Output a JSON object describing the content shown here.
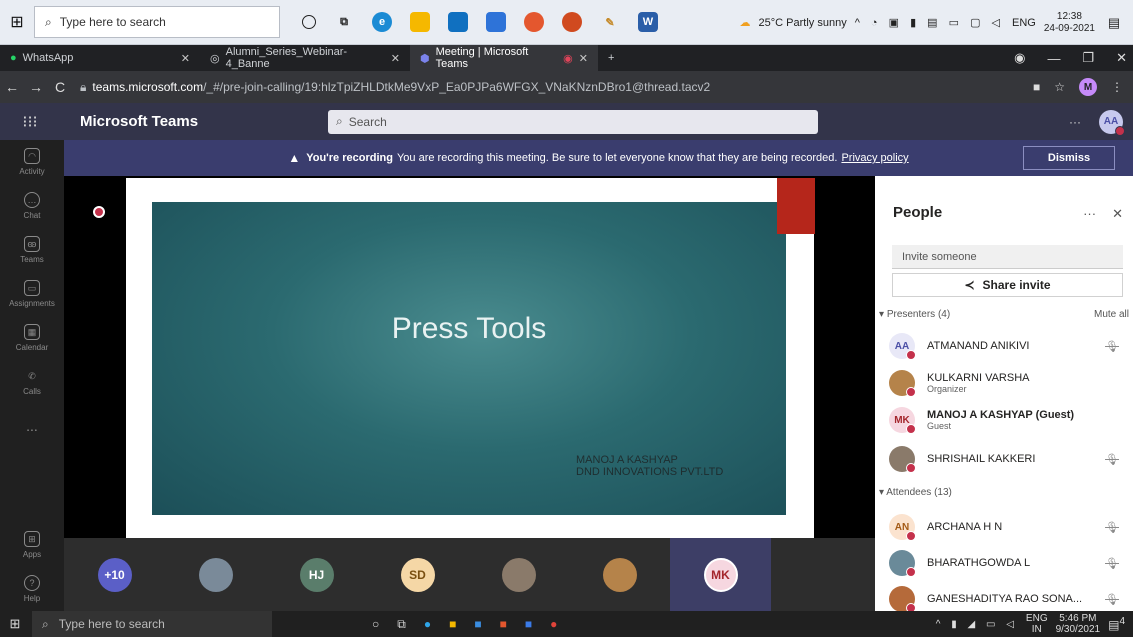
{
  "top_taskbar": {
    "search_placeholder": "Type here to search",
    "weather": "25°C  Partly sunny",
    "language": "ENG",
    "time": "12:38",
    "date": "24-09-2021"
  },
  "browser": {
    "tabs": [
      {
        "label": "WhatsApp",
        "icon": "whatsapp-icon"
      },
      {
        "label": "Alumni_Series_Webinar-4_Banne",
        "icon": "globe-icon"
      },
      {
        "label": "Meeting | Microsoft Teams",
        "icon": "teams-icon",
        "active": true
      }
    ],
    "new_tab": "+",
    "url_host": "teams.microsoft.com",
    "url_path": "/_#/pre-join-calling/19:hlzTpiZHLDtkMe9VxP_Ea0PJPa6WFGX_VNaKNznDBro1@thread.tacv2",
    "profile_initial": "M"
  },
  "teams": {
    "app_name": "Microsoft Teams",
    "search_placeholder": "Search",
    "user_initials": "AA",
    "more": "···"
  },
  "rail": {
    "items": [
      {
        "label": "Activity",
        "icon": "bell-icon"
      },
      {
        "label": "Chat",
        "icon": "chat-icon"
      },
      {
        "label": "Teams",
        "icon": "teams-group-icon"
      },
      {
        "label": "Assignments",
        "icon": "assignments-icon"
      },
      {
        "label": "Calendar",
        "icon": "calendar-icon"
      },
      {
        "label": "Calls",
        "icon": "phone-icon"
      },
      {
        "label": "...",
        "icon": "more-icon"
      }
    ],
    "bottom": [
      {
        "label": "Apps",
        "icon": "apps-icon"
      },
      {
        "label": "Help",
        "icon": "help-icon"
      }
    ]
  },
  "recording_banner": {
    "strong": "You're recording",
    "message": "You are recording this meeting. Be sure to let everyone know that they are being recorded.",
    "link": "Privacy policy",
    "dismiss": "Dismiss"
  },
  "slide": {
    "title": "Press Tools",
    "author_line1": "MANOJ A KASHYAP",
    "author_line2": "DND INNOVATIONS PVT.LTD"
  },
  "strip": [
    {
      "label": "+10",
      "color": "#5b5fc7",
      "kind": "count"
    },
    {
      "label": "",
      "color": "#7a8a99",
      "kind": "photo"
    },
    {
      "label": "HJ",
      "color": "#5a7d6b",
      "kind": "initials"
    },
    {
      "label": "SD",
      "color": "#f5d7a6",
      "text_color": "#7a4f10",
      "kind": "initials"
    },
    {
      "label": "",
      "color": "#8a7a6a",
      "kind": "photo"
    },
    {
      "label": "",
      "color": "#b5834a",
      "kind": "photo"
    },
    {
      "label": "MK",
      "color": "#f6d7e0",
      "text_color": "#a4262c",
      "kind": "initials",
      "highlight": true
    }
  ],
  "people": {
    "title": "People",
    "more": "···",
    "close": "✕",
    "invite_placeholder": "Invite someone",
    "share_label": "Share invite",
    "presenters_label": "Presenters (4)",
    "mute_all": "Mute all",
    "attendees_label": "Attendees (13)",
    "presenters": [
      {
        "name": "ATMANAND ANIKIVI",
        "initials": "AA",
        "bg": "#e8e8f7",
        "fg": "#4b4fa6",
        "role": "",
        "muted": true,
        "bold": false
      },
      {
        "name": "KULKARNI VARSHA",
        "initials": "",
        "bg": "#b5834a",
        "fg": "#fff",
        "role": "Organizer",
        "muted": false,
        "bold": false
      },
      {
        "name": "MANOJ A KASHYAP (Guest)",
        "initials": "MK",
        "bg": "#f6d7e0",
        "fg": "#a4262c",
        "role": "Guest",
        "muted": false,
        "bold": true
      },
      {
        "name": "SHRISHAIL KAKKERI",
        "initials": "",
        "bg": "#8a7a6a",
        "fg": "#fff",
        "role": "",
        "muted": true,
        "bold": false
      }
    ],
    "attendees": [
      {
        "name": "ARCHANA H N",
        "initials": "AN",
        "bg": "#fbe3cf",
        "fg": "#a35a16",
        "muted": true
      },
      {
        "name": "BHARATHGOWDA L",
        "initials": "",
        "bg": "#6a8a99",
        "fg": "#fff",
        "muted": true
      },
      {
        "name": "GANESHADITYA RAO SONA...",
        "initials": "",
        "bg": "#b56a3a",
        "fg": "#fff",
        "muted": true
      }
    ]
  },
  "bottom_taskbar": {
    "search_placeholder": "Type here to search",
    "language": "ENG",
    "region": "IN",
    "time": "5:46 PM",
    "date": "9/30/2021",
    "notif_count": "4"
  }
}
